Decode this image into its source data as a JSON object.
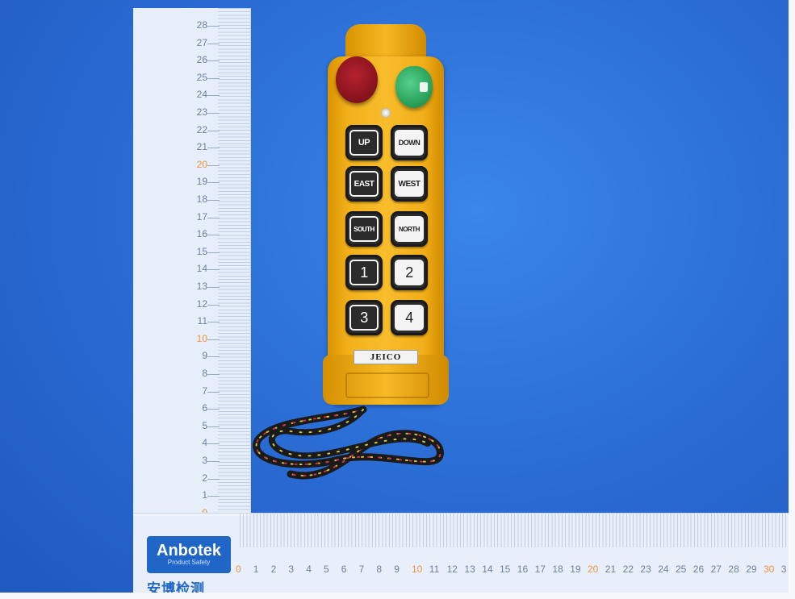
{
  "ruler_vertical": {
    "labels": [
      {
        "text": "28",
        "orange": false
      },
      {
        "text": "27",
        "orange": false
      },
      {
        "text": "26",
        "orange": false
      },
      {
        "text": "25",
        "orange": false
      },
      {
        "text": "24",
        "orange": false
      },
      {
        "text": "23",
        "orange": false
      },
      {
        "text": "22",
        "orange": false
      },
      {
        "text": "21",
        "orange": false
      },
      {
        "text": "20",
        "orange": true
      },
      {
        "text": "19",
        "orange": false
      },
      {
        "text": "18",
        "orange": false
      },
      {
        "text": "17",
        "orange": false
      },
      {
        "text": "16",
        "orange": false
      },
      {
        "text": "15",
        "orange": false
      },
      {
        "text": "14",
        "orange": false
      },
      {
        "text": "13",
        "orange": false
      },
      {
        "text": "12",
        "orange": false
      },
      {
        "text": "11",
        "orange": false
      },
      {
        "text": "10",
        "orange": true
      },
      {
        "text": "9",
        "orange": false
      },
      {
        "text": "8",
        "orange": false
      },
      {
        "text": "7",
        "orange": false
      },
      {
        "text": "6",
        "orange": false
      },
      {
        "text": "5",
        "orange": false
      },
      {
        "text": "4",
        "orange": false
      },
      {
        "text": "3",
        "orange": false
      },
      {
        "text": "2",
        "orange": false
      },
      {
        "text": "1",
        "orange": false
      },
      {
        "text": "0",
        "orange": true
      }
    ]
  },
  "ruler_horizontal": {
    "labels": [
      {
        "text": "0",
        "orange": true
      },
      {
        "text": "1",
        "orange": false
      },
      {
        "text": "2",
        "orange": false
      },
      {
        "text": "3",
        "orange": false
      },
      {
        "text": "4",
        "orange": false
      },
      {
        "text": "5",
        "orange": false
      },
      {
        "text": "6",
        "orange": false
      },
      {
        "text": "7",
        "orange": false
      },
      {
        "text": "8",
        "orange": false
      },
      {
        "text": "9",
        "orange": false
      },
      {
        "text": "10",
        "orange": true
      },
      {
        "text": "11",
        "orange": false
      },
      {
        "text": "12",
        "orange": false
      },
      {
        "text": "13",
        "orange": false
      },
      {
        "text": "14",
        "orange": false
      },
      {
        "text": "15",
        "orange": false
      },
      {
        "text": "16",
        "orange": false
      },
      {
        "text": "17",
        "orange": false
      },
      {
        "text": "18",
        "orange": false
      },
      {
        "text": "19",
        "orange": false
      },
      {
        "text": "20",
        "orange": true
      },
      {
        "text": "21",
        "orange": false
      },
      {
        "text": "22",
        "orange": false
      },
      {
        "text": "23",
        "orange": false
      },
      {
        "text": "24",
        "orange": false
      },
      {
        "text": "25",
        "orange": false
      },
      {
        "text": "26",
        "orange": false
      },
      {
        "text": "27",
        "orange": false
      },
      {
        "text": "28",
        "orange": false
      },
      {
        "text": "29",
        "orange": false
      },
      {
        "text": "30",
        "orange": true
      },
      {
        "text": "3",
        "orange": false
      }
    ]
  },
  "logo": {
    "main": "Anbotek",
    "sub": "Product Safety",
    "chinese": "安博检测"
  },
  "remote": {
    "brand": "JEICO",
    "buttons": [
      {
        "label": "UP",
        "style": "inv"
      },
      {
        "label": "DOWN",
        "style": "plain"
      },
      {
        "label": "EAST",
        "style": "inv"
      },
      {
        "label": "WEST",
        "style": "plain"
      },
      {
        "label": "SOUTH",
        "style": "inv"
      },
      {
        "label": "NORTH",
        "style": "plain"
      },
      {
        "label": "1",
        "style": "inv-num"
      },
      {
        "label": "2",
        "style": "num"
      },
      {
        "label": "3",
        "style": "inv-num"
      },
      {
        "label": "4",
        "style": "num"
      }
    ]
  },
  "colors": {
    "background_blue": "#2b6ed6",
    "remote_body": "#f3b11a",
    "estop_red": "#8e1520",
    "key_green": "#2aa35d",
    "ruler_orange_numbers": "#f0913a"
  }
}
